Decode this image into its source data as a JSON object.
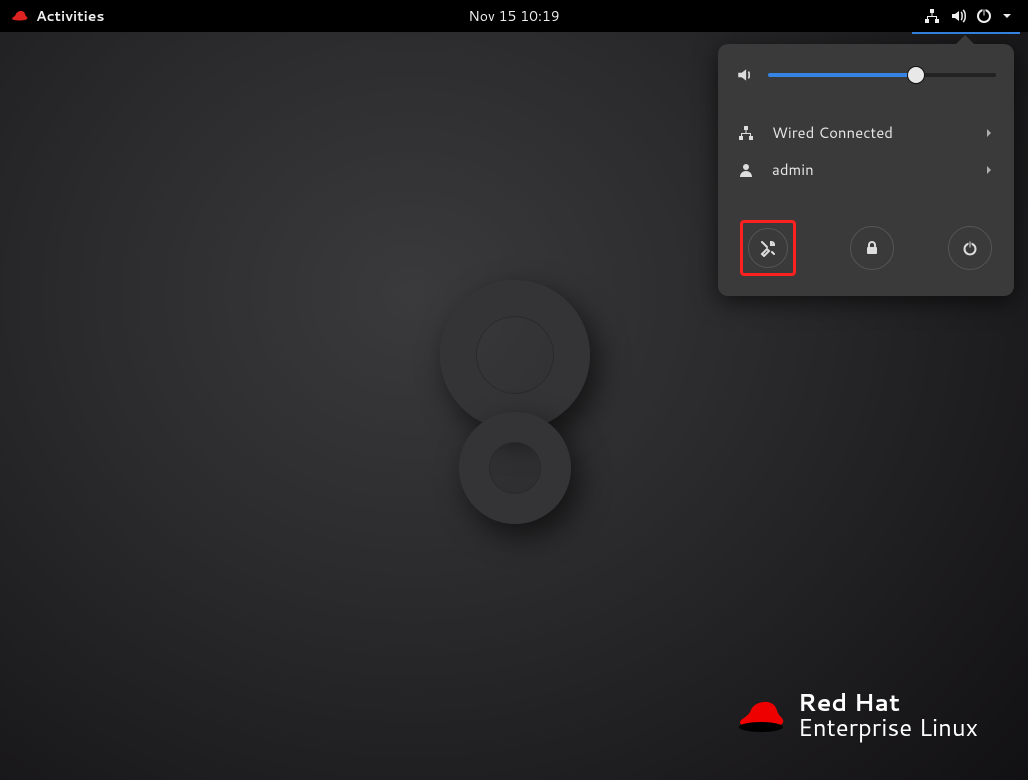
{
  "topbar": {
    "activities_label": "Activities",
    "datetime": "Nov 15  10:19"
  },
  "system_menu": {
    "volume_percent": 65,
    "network_label": "Wired Connected",
    "user_label": "admin"
  },
  "branding": {
    "line1": "Red Hat",
    "line2": "Enterprise Linux"
  }
}
